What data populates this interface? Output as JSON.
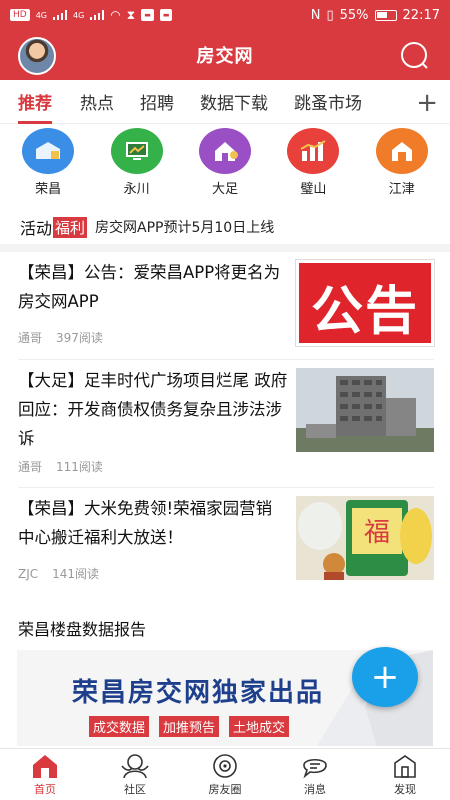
{
  "status_bar": {
    "left_items": [
      "HD",
      "4G",
      "4G"
    ],
    "battery": "55%",
    "time": "22:17"
  },
  "header": {
    "title": "房交网"
  },
  "tabs": [
    {
      "label": "推荐",
      "active": true
    },
    {
      "label": "热点",
      "active": false
    },
    {
      "label": "招聘",
      "active": false
    },
    {
      "label": "数据下载",
      "active": false
    },
    {
      "label": "跳蚤市场",
      "active": false
    }
  ],
  "tabs_more_icon": "plus-icon",
  "cities": [
    {
      "name": "荣昌",
      "color": "#3a8ee6",
      "icon": "house-icon"
    },
    {
      "name": "永川",
      "color": "#35b14a",
      "icon": "monitor-icon"
    },
    {
      "name": "大足",
      "color": "#9a4fc4",
      "icon": "home-icon"
    },
    {
      "name": "璧山",
      "color": "#e8403a",
      "icon": "chart-icon"
    },
    {
      "name": "江津",
      "color": "#f07c2a",
      "icon": "building-icon"
    }
  ],
  "notice": {
    "activity": "活动",
    "welfare": "福利",
    "text": "房交网APP预计5月10日上线"
  },
  "news": [
    {
      "title": "【荣昌】公告：爱荣昌APP将更名为房交网APP",
      "author": "通哥",
      "reads": "397阅读",
      "thumb_text": "公告"
    },
    {
      "title": "【大足】足丰时代广场项目烂尾 政府回应：开发商债权债务复杂且涉法涉诉",
      "author": "通哥",
      "reads": "111阅读"
    },
    {
      "title": "【荣昌】大米免费领!荣福家园营销中心搬迁福利大放送！",
      "author": "ZJC",
      "reads": "141阅读"
    }
  ],
  "report": {
    "title": "荣昌楼盘数据报告",
    "banner_text": "荣昌房交网独家出品",
    "tags": [
      "成交数据",
      "加推预告",
      "土地成交"
    ]
  },
  "fab_label": "+",
  "bottom_nav": [
    {
      "label": "首页",
      "icon": "home-icon",
      "active": true
    },
    {
      "label": "社区",
      "icon": "community-icon",
      "active": false
    },
    {
      "label": "房友圈",
      "icon": "moments-icon",
      "active": false
    },
    {
      "label": "消息",
      "icon": "message-icon",
      "active": false
    },
    {
      "label": "发现",
      "icon": "discover-icon",
      "active": false
    }
  ],
  "colors": {
    "brand": "#d83a3f",
    "fab": "#1aa0e8"
  }
}
